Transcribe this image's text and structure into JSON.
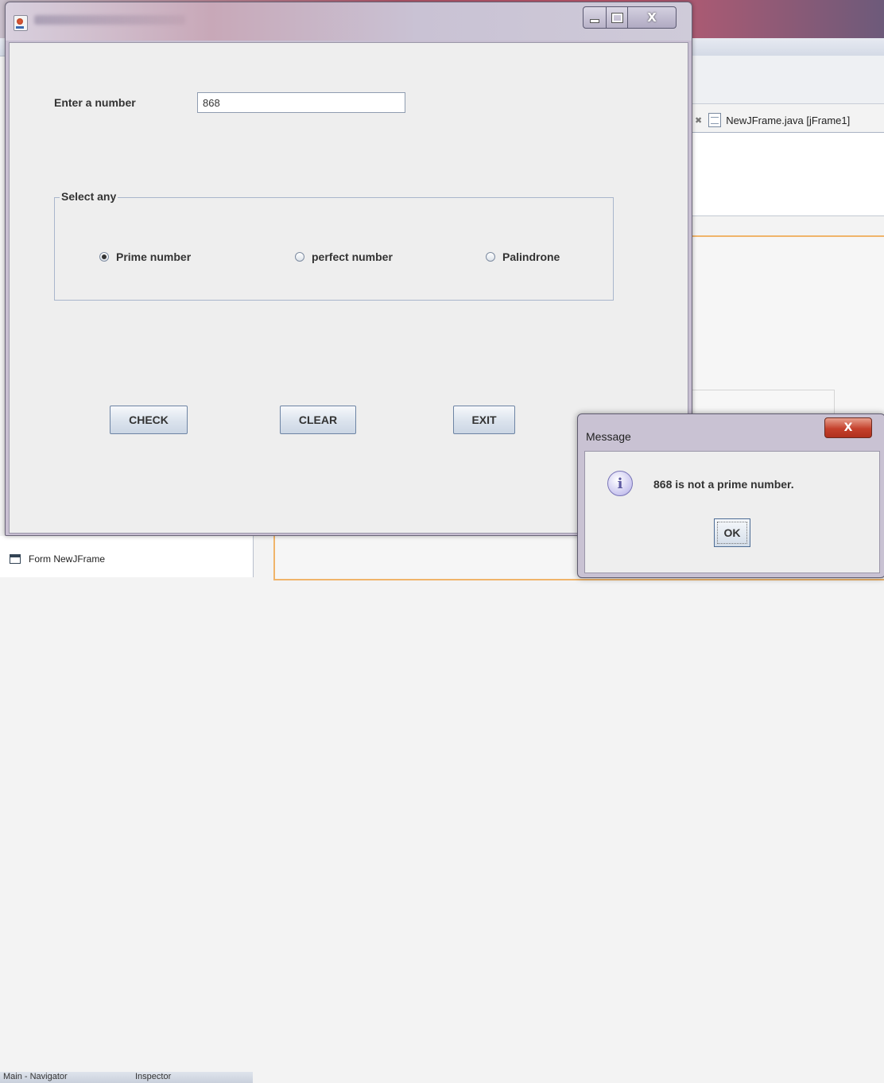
{
  "ide": {
    "editor_tab_label": "NewJFrame.java [jFrame1]",
    "navigator_tabs": [
      "Main - Navigator",
      "Inspector"
    ],
    "tree_item": "Form NewJFrame"
  },
  "frame": {
    "title": "",
    "controls": {
      "minimize": "minimize-icon",
      "maximize": "maximize-icon",
      "close": "close-icon"
    },
    "input_label": "Enter a number",
    "input_value": "868",
    "group_title": "Select any",
    "options": [
      {
        "label": "Prime number",
        "selected": true
      },
      {
        "label": "perfect number",
        "selected": false
      },
      {
        "label": "Palindrone",
        "selected": false
      }
    ],
    "buttons": {
      "check": "CHECK",
      "clear": "CLEAR",
      "exit": "EXIT"
    }
  },
  "dialog": {
    "title": "Message",
    "icon": "info-icon",
    "message": "868 is not a prime number.",
    "ok_label": "OK"
  },
  "colors": {
    "titlebar_accent": "#c25a70",
    "dialog_close": "#c4412c",
    "button_border": "#6d84a4"
  }
}
